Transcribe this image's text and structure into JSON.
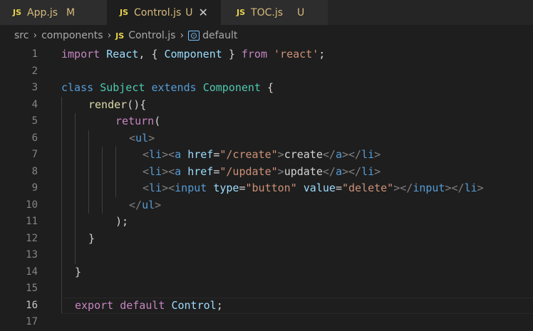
{
  "tabs": [
    {
      "icon": "JS",
      "name": "App.js",
      "status": "M"
    },
    {
      "icon": "JS",
      "name": "Control.js",
      "status": "U",
      "close": "✕"
    },
    {
      "icon": "JS",
      "name": "TOC.js",
      "status": "U"
    }
  ],
  "breadcrumb": {
    "segments": [
      "src",
      "components",
      "Control.js",
      "default"
    ],
    "file_icon": "JS",
    "symbol_icon": "symbol-icon"
  },
  "editor": {
    "current_line": 16,
    "line_numbers": [
      "1",
      "2",
      "3",
      "4",
      "5",
      "6",
      "7",
      "8",
      "9",
      "10",
      "11",
      "12",
      "13",
      "14",
      "15",
      "16",
      "17"
    ],
    "tokens": {
      "import": "import",
      "react_name": "React",
      "comma": ",",
      "lbrace": "{",
      "component": "Component",
      "rbrace": "}",
      "from": "from",
      "react_str": "'react'",
      "semi": ";",
      "class_kw": "class",
      "subject": "Subject",
      "extends": "extends",
      "component2": "Component",
      "open_brace": "{",
      "render": "render",
      "render_paren": "(){",
      "return": "return",
      "return_paren": "(",
      "ul_open_l": "<",
      "ul": "ul",
      "ul_open_r": ">",
      "li_l": "<",
      "li": "li",
      "li_r": ">",
      "a_l": "<",
      "a": "a",
      "href": "href",
      "eq": "=",
      "href_create": "\"/create\"",
      "a_r": ">",
      "create": "create",
      "a_close_l": "</",
      "a_close": "a",
      "a_close_r": ">",
      "li_close_l": "</",
      "li_close": "li",
      "li_close_r": ">",
      "href_update": "\"/update\"",
      "update": "update",
      "input": "input",
      "type": "type",
      "type_val": "\"button\"",
      "value": "value",
      "value_val": "\"delete\"",
      "self_close_r": "></",
      "input_close": "input",
      "ul_close_l": "</",
      "ul_close": "ul",
      "ul_close_r": ">",
      "paren_semi": ");",
      "close_brace": "}",
      "export": "export",
      "default": "default",
      "control": "Control",
      "end_semi": ";"
    }
  },
  "colors": {
    "background": "#1e1e1e",
    "keyword": "#569cd6",
    "control_keyword": "#c586c0",
    "class_name": "#4ec9b0",
    "variable": "#9cdcfe",
    "function": "#dcdcaa",
    "string": "#ce9178",
    "modified_badge": "#d7ba7d"
  }
}
